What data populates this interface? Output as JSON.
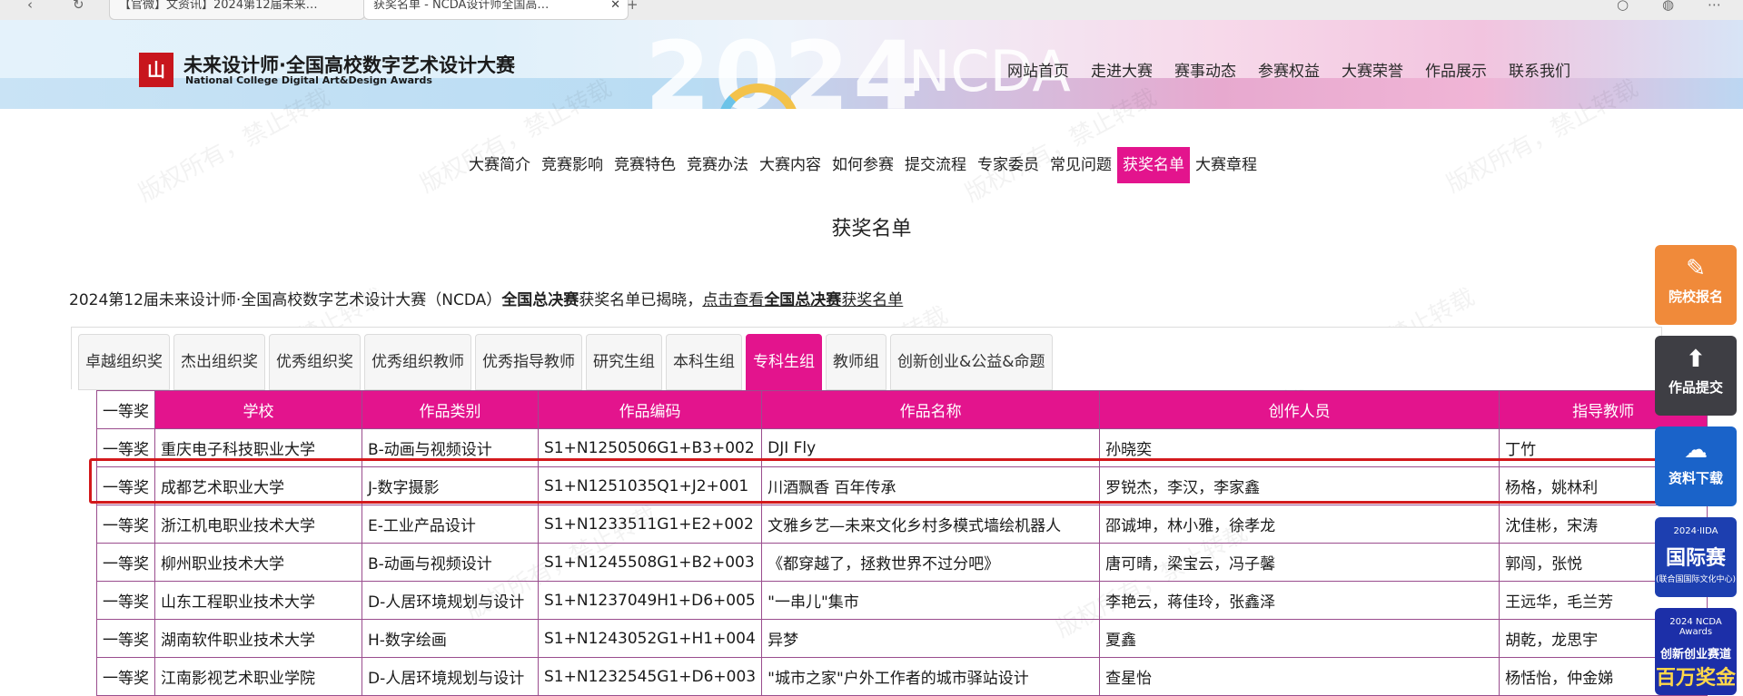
{
  "browser": {
    "tab1_title": "【官微】文资讯】2024第12届未来…",
    "tab2_title": "获奖名单 - NCDA设计师全国高…"
  },
  "header": {
    "logo_mark": "山",
    "title_cn": "未来设计师·全国高校数字艺术设计大赛",
    "title_en": "National College Digital Art&Design Awards",
    "banner_year": "2024",
    "banner_ncda": "NCDA",
    "nav": [
      "网站首页",
      "走进大赛",
      "赛事动态",
      "参赛权益",
      "大赛荣誉",
      "作品展示",
      "联系我们"
    ]
  },
  "watermark": "版权所有，禁止转载",
  "subnav": {
    "items": [
      "大赛简介",
      "竞赛影响",
      "竞赛特色",
      "竞赛办法",
      "大赛内容",
      "如何参赛",
      "提交流程",
      "专家委员",
      "常见问题",
      "获奖名单",
      "大赛章程"
    ],
    "active_index": 9
  },
  "page_title": "获奖名单",
  "intro": {
    "part1": "2024第12届未来设计师·全国高校数字艺术设计大赛（NCDA）",
    "bold1": "全国总决赛",
    "part2": "获奖名单已揭晓，",
    "link_prefix": "点击查看",
    "bold2": "全国总决赛",
    "link_suffix": "获奖名单"
  },
  "tabs": {
    "items": [
      "卓越组织奖",
      "杰出组织奖",
      "优秀组织奖",
      "优秀组织教师",
      "优秀指导教师",
      "研究生组",
      "本科生组",
      "专科生组",
      "教师组",
      "创新创业&公益&命题"
    ],
    "active_index": 7
  },
  "table": {
    "header_rank": "一等奖",
    "columns": [
      "学校",
      "作品类别",
      "作品编码",
      "作品名称",
      "创作人员",
      "指导教师"
    ],
    "rows": [
      {
        "rank": "一等奖",
        "school": "重庆电子科技职业大学",
        "category": "B-动画与视频设计",
        "code": "S1+N1250506G1+B3+002",
        "title": "DJI Fly",
        "creators": "孙晓奕",
        "advisors": "丁竹"
      },
      {
        "rank": "一等奖",
        "school": "成都艺术职业大学",
        "category": "J-数字摄影",
        "code": "S1+N1251035Q1+J2+001",
        "title": "川酒飘香 百年传承",
        "creators": "罗锐杰，李汉，李家鑫",
        "advisors": "杨格，姚林利"
      },
      {
        "rank": "一等奖",
        "school": "浙江机电职业技术大学",
        "category": "E-工业产品设计",
        "code": "S1+N1233511G1+E2+002",
        "title": "文雅乡艺—未来文化乡村多模式墙绘机器人",
        "creators": "邵诚坤，林小雅，徐孝龙",
        "advisors": "沈佳彬，宋涛"
      },
      {
        "rank": "一等奖",
        "school": "柳州职业技术大学",
        "category": "B-动画与视频设计",
        "code": "S1+N1245508G1+B2+003",
        "title": "《都穿越了，拯救世界不过分吧》",
        "creators": "唐可晴，梁宝云，冯子馨",
        "advisors": "郭闯，张悦"
      },
      {
        "rank": "一等奖",
        "school": "山东工程职业技术大学",
        "category": "D-人居环境规划与设计",
        "code": "S1+N1237049H1+D6+005",
        "title": "\"一串儿\"集市",
        "creators": "李艳云，蒋佳玲，张鑫泽",
        "advisors": "王远华，毛兰芳"
      },
      {
        "rank": "一等奖",
        "school": "湖南软件职业技术大学",
        "category": "H-数字绘画",
        "code": "S1+N1243052G1+H1+004",
        "title": "异梦",
        "creators": "夏鑫",
        "advisors": "胡乾，龙思宇"
      },
      {
        "rank": "一等奖",
        "school": "江南影视艺术职业学院",
        "category": "D-人居环境规划与设计",
        "code": "S1+N1232545G1+D6+003",
        "title": "\"城市之家\"户外工作者的城市驿站设计",
        "creators": "查星怡",
        "advisors": "杨恬怡，仲金娣"
      }
    ]
  },
  "side_buttons": {
    "b1": "院校报名",
    "b2": "作品提交",
    "b3": "资料下载",
    "b4_top": "2024·IIDA",
    "b4": "国际赛",
    "b4_small": "(联合国国际文化中心)",
    "b5_top": "2024 NCDA Awards",
    "b5": "创新创业赛道",
    "b5_big": "百万奖金"
  },
  "colors": {
    "accent": "#e3148d",
    "highlight_border": "#d3191c",
    "table_border": "#9a4d8e"
  }
}
